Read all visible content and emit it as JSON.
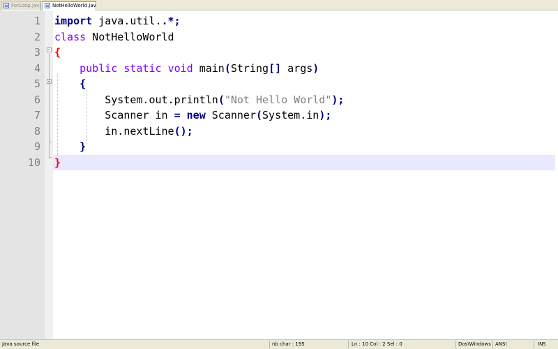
{
  "tabs": [
    {
      "label": "ForLoop.java",
      "active": false
    },
    {
      "label": "NotHelloWorld.java",
      "active": true
    }
  ],
  "editor": {
    "line_numbers": [
      "1",
      "2",
      "3",
      "4",
      "5",
      "6",
      "7",
      "8",
      "9",
      "10"
    ],
    "lines": {
      "l1": {
        "kw": "import",
        "rest": " java.util.",
        "op": ".*",
        "end": ";"
      },
      "l2": {
        "kw": "class",
        "rest": " NotHelloWorld"
      },
      "l3": {
        "brace": "{"
      },
      "l4": {
        "indent": "    ",
        "kw1": "public",
        "kw2": "static",
        "kw3": "void",
        "rest": "main",
        "p1": "(",
        "type": "String",
        "br": "[]",
        "arg": " args",
        "p2": ")"
      },
      "l5": {
        "indent": "    ",
        "brace": "{"
      },
      "l6": {
        "indent": "        ",
        "pre": "System.out.println",
        "p1": "(",
        "str": "\"Not Hello World\"",
        "p2": ")",
        "end": ";"
      },
      "l7": {
        "indent": "        ",
        "pre": "Scanner in ",
        "eq": "=",
        "kw": "new",
        "post": " Scanner",
        "p1": "(",
        "mid": "System.in",
        "p2": ")",
        "end": ";"
      },
      "l8": {
        "indent": "        ",
        "pre": "in.nextLine",
        "p1": "()",
        "end": ";"
      },
      "l9": {
        "indent": "    ",
        "brace": "}"
      },
      "l10": {
        "brace": "}"
      }
    },
    "current_line": 10
  },
  "status": {
    "file_type": "Java source file",
    "nb_char": "nb char : 195",
    "position": "Ln : 10   Col : 2   Sel : 0",
    "eol": "Dos\\Windows",
    "encoding": "ANSI",
    "mode": "INS"
  },
  "colors": {
    "keyword": "#000080",
    "type_keyword": "#8000ff",
    "string": "#808080",
    "brace_match": "#ff0000",
    "current_line_bg": "#e8e8ff",
    "gutter_bg": "#e4e4e4"
  }
}
